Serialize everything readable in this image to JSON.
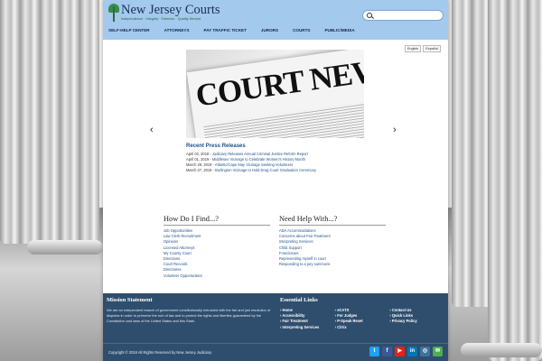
{
  "header": {
    "logo_title": "New Jersey Courts",
    "logo_tagline": "Independence · Integrity · Fairness · Quality Service",
    "search_placeholder": ""
  },
  "nav": [
    {
      "label": "SELF-HELP CENTER"
    },
    {
      "label": "ATTORNEYS"
    },
    {
      "label": "PAY TRAFFIC TICKET"
    },
    {
      "label": "JURORS"
    },
    {
      "label": "COURTS"
    },
    {
      "label": "PUBLIC/MEDIA"
    }
  ],
  "language": {
    "english": "English",
    "spanish": "Español"
  },
  "banner": {
    "headline": "COURT NEWS"
  },
  "carousel": {
    "prev": "‹",
    "next": "›"
  },
  "press": {
    "title": "Recent Press Releases",
    "items": [
      {
        "date": "April 02, 2019 - ",
        "text": "Judiciary Releases Annual Criminal Justice Reform Report"
      },
      {
        "date": "April 01, 2019 - ",
        "text": "Middlesex Vicinage to Celebrate Women's History Month"
      },
      {
        "date": "March 29, 2019 - ",
        "text": "Atlantic/Cape May Vicinage Seeking Volunteers"
      },
      {
        "date": "March 27, 2019 - ",
        "text": "Burlington Vicinage to Hold Drug Court Graduation Ceremony"
      }
    ]
  },
  "how": {
    "title": "How Do I Find...?",
    "links": [
      "Job Opportunities",
      "Law Clerk Recruitment",
      "Opinions",
      "Licensed Attorneys",
      "My County Court",
      "Directions",
      "Court Records",
      "Directories",
      "Volunteer Opportunities"
    ]
  },
  "help": {
    "title": "Need Help With...?",
    "links": [
      "ADA Accommodations",
      "Concerns about Fair Treatment",
      "Interpreting Services",
      "Child Support",
      "Foreclosure",
      "Representing myself in court",
      "Responding to a jury summons"
    ]
  },
  "footer": {
    "mission_title": "Mission Statement",
    "mission_text": "We are an independent branch of government constitutionally entrusted with the fair and just resolution of disputes in order to preserve the rule of law and to protect the rights and liberties guaranteed by the Constitution and laws of the United States and this State.",
    "essential_title": "Essential Links",
    "col1": [
      "Home",
      "Accessibility",
      "Fair Treatment",
      "Interpreting Services"
    ],
    "col2": [
      "eCATS",
      "For Judges",
      "P-Speak Reset",
      "Citrix"
    ],
    "col3": [
      "Contact Us",
      "Quick Links",
      "Privacy Policy"
    ],
    "copyright": "Copyright © 2018 All Rights Reserved by New Jersey Judiciary.",
    "social": [
      {
        "icon": "twitter-icon",
        "glyph": "t",
        "color": "#1da1f2"
      },
      {
        "icon": "facebook-icon",
        "glyph": "f",
        "color": "#3b5998"
      },
      {
        "icon": "youtube-icon",
        "glyph": "▶",
        "color": "#e62117"
      },
      {
        "icon": "linkedin-icon",
        "glyph": "in",
        "color": "#0077b5"
      },
      {
        "icon": "instagram-icon",
        "glyph": "◎",
        "color": "#3f729b"
      },
      {
        "icon": "wechat-icon",
        "glyph": "✉",
        "color": "#4caf50"
      }
    ]
  }
}
